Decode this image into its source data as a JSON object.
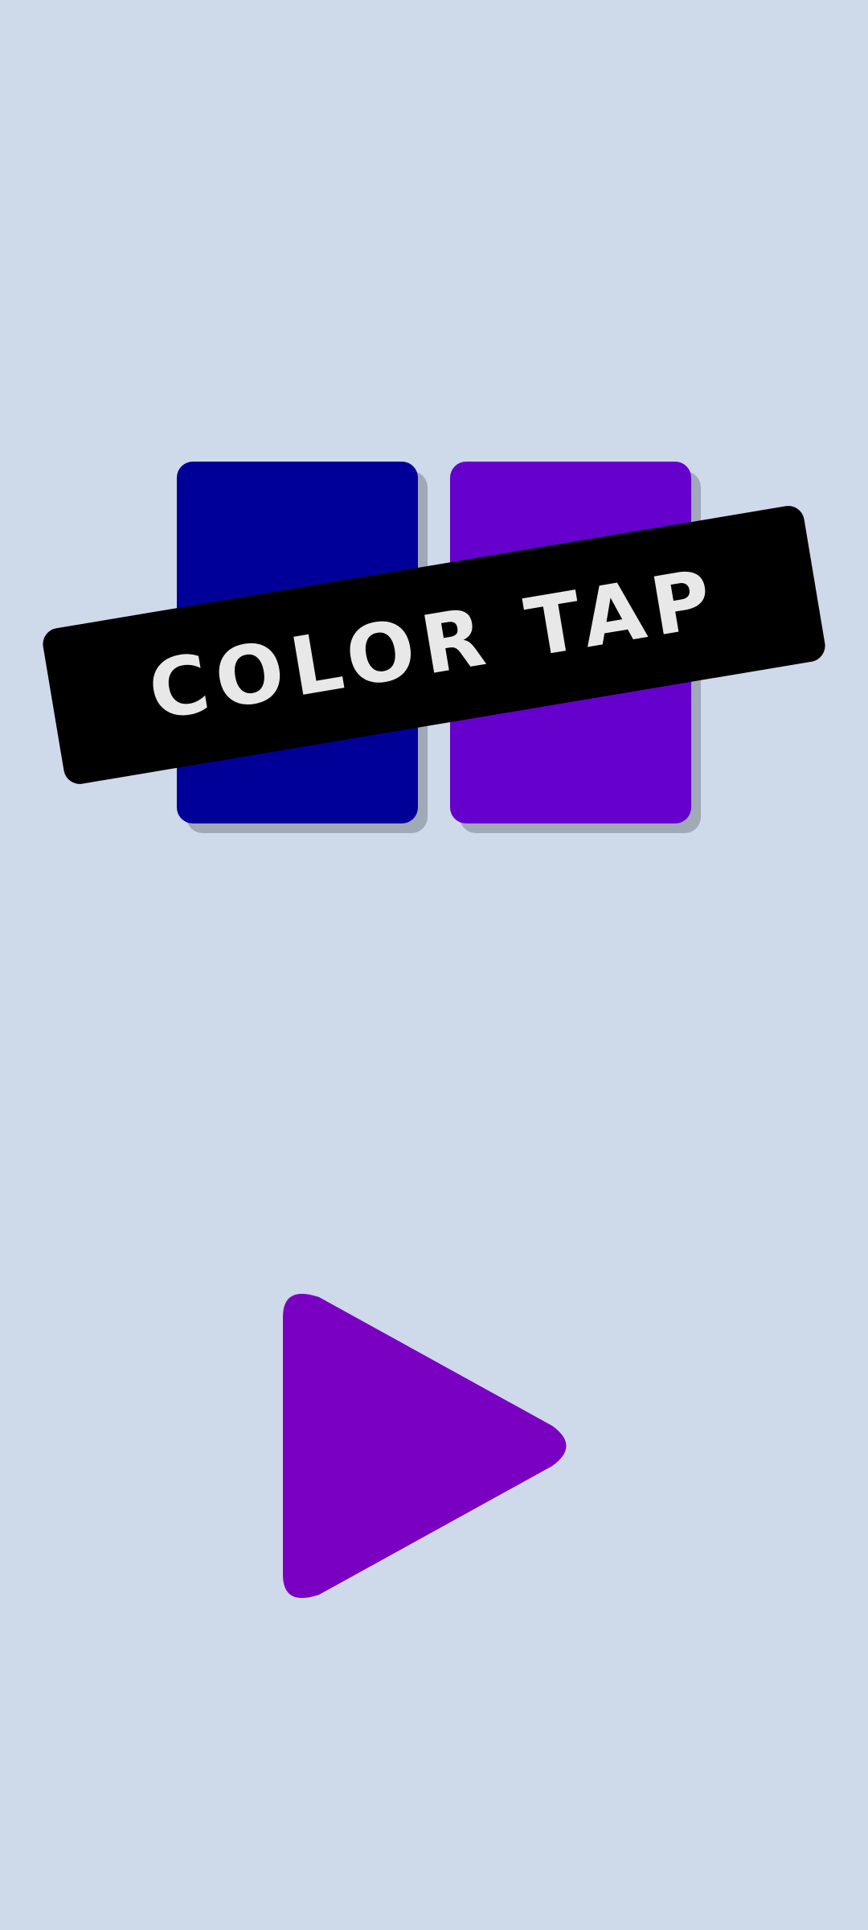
{
  "colors": {
    "background": "#ced9ea",
    "tile_left": "#000099",
    "tile_right": "#6600cc",
    "banner": "#000000",
    "banner_text": "#e8e8e8",
    "play_button": "#7a00c2"
  },
  "title": {
    "text": "COLOR TAP"
  },
  "play_button": {
    "icon": "play-icon"
  }
}
